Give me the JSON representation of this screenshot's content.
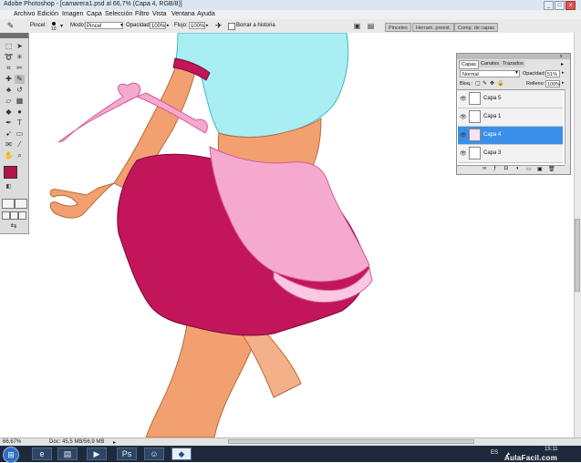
{
  "window": {
    "title": "Adobe Photoshop - [camarera1.psd al 66,7% (Capa 4, RGB/8)]",
    "controls": [
      "_",
      "□",
      "x"
    ]
  },
  "menu": [
    "Archivo",
    "Edición",
    "Imagen",
    "Capa",
    "Selección",
    "Filtro",
    "Vista",
    "Ventana",
    "Ayuda"
  ],
  "options": {
    "brush_label": "Pincel:",
    "brush_size": "10",
    "mode_label": "Modo:",
    "mode_value": "Pincel",
    "opacity_label": "Opacidad:",
    "opacity_value": "100%",
    "flow_label": "Flujo:",
    "flow_value": "100%",
    "erase_history_label": "Borrar a historia"
  },
  "dock_tabs": [
    "Pinceles",
    "Herram. preest.",
    "Comp. de capas"
  ],
  "layers_panel": {
    "tabs": [
      "Capas",
      "Canales",
      "Trazados"
    ],
    "blend_mode": "Normal",
    "opacity_label": "Opacidad:",
    "opacity_value": "51%",
    "lock_label": "Bloq.:",
    "fill_label": "Relleno:",
    "fill_value": "100%",
    "layers": [
      {
        "name": "Capa 5",
        "selected": false
      },
      {
        "name": "Capa 1",
        "selected": false
      },
      {
        "name": "Capa 4",
        "selected": true
      },
      {
        "name": "Capa 3",
        "selected": false
      }
    ]
  },
  "status": {
    "zoom": "66,67%",
    "doc": "Doc: 45,5 MB/56,9 MB"
  },
  "taskbar": {
    "lang": "ES",
    "time": "15:11",
    "watermark": "AulaFacil.com",
    "apps": [
      "start-orb",
      "internet-explorer",
      "file-explorer",
      "media-player",
      "photoshop",
      "messenger",
      "network-app"
    ]
  },
  "colors": {
    "selection_blue": "#3a8fe8",
    "skirt_crimson": "#c3155a",
    "apron_pink": "#f6a9cf",
    "shirt_cyan": "#a9eef2",
    "skin": "#f2a070",
    "foreground_color": "#b41447"
  }
}
